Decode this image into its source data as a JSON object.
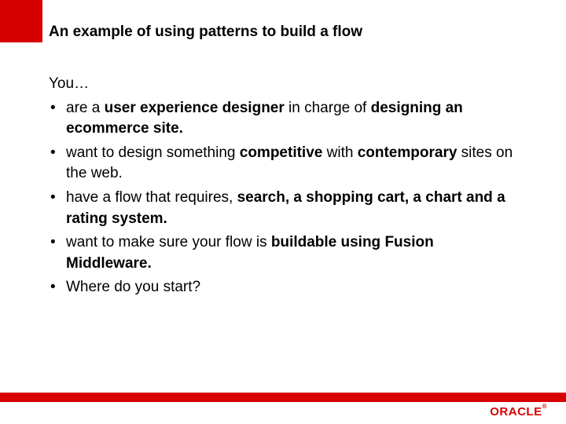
{
  "title": "An example of using patterns to build a flow",
  "intro": "You…",
  "bullets": [
    "are a <b>user experience designer</b> in charge of <b>designing an ecommerce site.</b>",
    "want to design something <b>competitive</b> with <b>contemporary</b> sites on the web.",
    "have a flow that requires, <b>search, a shopping cart, a chart and a rating system.</b>",
    "want to make sure your flow is <b>buildable using Fusion Middleware.</b>",
    "Where do you start?"
  ],
  "logo": {
    "text": "ORACLE",
    "reg": "®"
  }
}
